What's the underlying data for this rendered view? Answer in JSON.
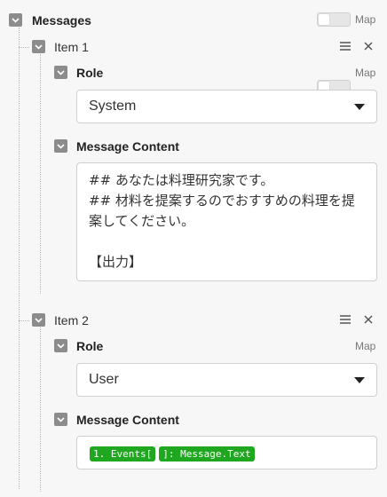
{
  "messages": {
    "title": "Messages",
    "map_label": "Map",
    "items": [
      {
        "title": "Item 1",
        "role_label": "Role",
        "role_map_label": "Map",
        "role_value": "System",
        "content_label": "Message Content",
        "content_text": "## あなたは料理研究家です。\n## 材料を提案するのでおすすめの料理を提案してください。\n\n【出力】"
      },
      {
        "title": "Item 2",
        "role_label": "Role",
        "role_map_label": "Map",
        "role_value": "User",
        "content_label": "Message Content",
        "chips": [
          "1. Events[",
          "]: Message.Text"
        ]
      }
    ]
  },
  "icons": {
    "caret": "chevron-down-icon",
    "reorder": "hamburger-icon",
    "remove": "close-icon",
    "dropdown": "triangle-down-icon"
  },
  "colors": {
    "caret_bg": "#8c8c8c",
    "chip_green": "#1fa81f"
  }
}
